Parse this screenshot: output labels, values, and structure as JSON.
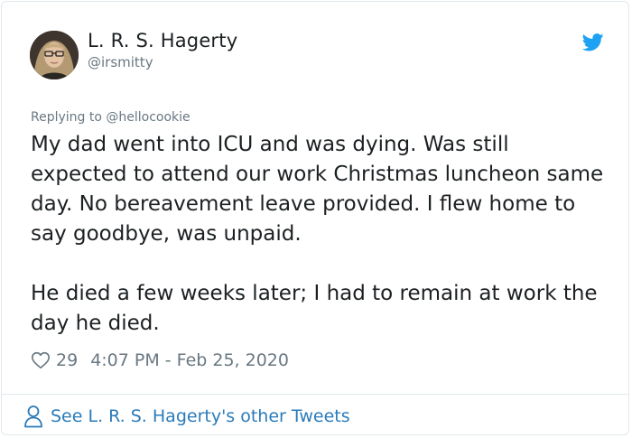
{
  "user": {
    "display_name": "L. R. S. Hagerty",
    "handle": "@irsmitty"
  },
  "tweet": {
    "reply_prefix": "Replying to ",
    "reply_to": "@hellocookie",
    "paragraphs": [
      "My dad went into ICU and was dying. Was still expected to attend our work Christmas luncheon same day. No bereavement leave provided. I flew home to say goodbye, was unpaid.",
      "He died a few weeks later; I had to remain at work the day he died."
    ],
    "likes": "29",
    "timestamp": "4:07 PM - Feb 25, 2020"
  },
  "footer": {
    "link_text": "See L. R. S. Hagerty's other Tweets"
  },
  "icons": {
    "brand": "twitter-bird-icon",
    "like": "heart-icon",
    "profile": "person-icon"
  },
  "colors": {
    "twitter_blue": "#1da1f2",
    "link_blue": "#2b7bb9",
    "text_primary": "#1c2022",
    "text_secondary": "#697882",
    "border": "#e1e8ed"
  }
}
